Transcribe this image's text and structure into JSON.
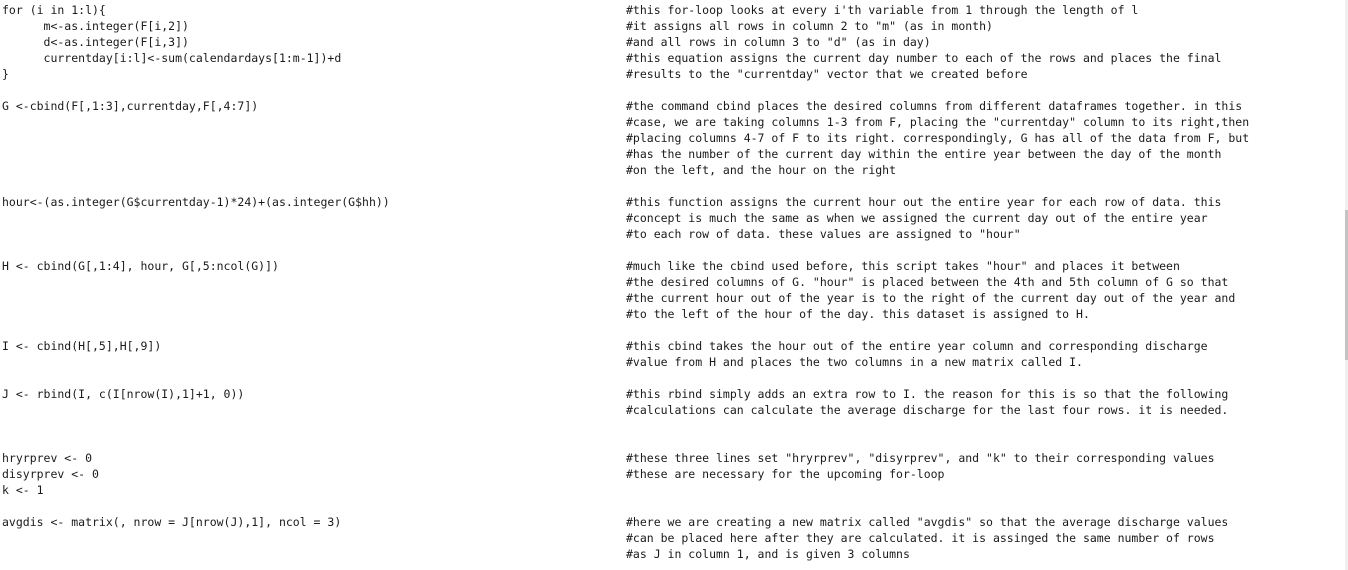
{
  "editor": {
    "lines": [
      {
        "code": "for (i in 1:l){",
        "comment": "#this for-loop looks at every i'th variable from 1 through the length of l"
      },
      {
        "code": "      m<-as.integer(F[i,2])",
        "comment": "#it assigns all rows in column 2 to \"m\" (as in month)"
      },
      {
        "code": "      d<-as.integer(F[i,3])",
        "comment": "#and all rows in column 3 to \"d\" (as in day)"
      },
      {
        "code": "      currentday[i:l]<-sum(calendardays[1:m-1])+d",
        "comment": "#this equation assigns the current day number to each of the rows and places the final"
      },
      {
        "code": "}",
        "comment": "#results to the \"currentday\" vector that we created before"
      },
      {
        "code": "",
        "comment": ""
      },
      {
        "code": "G <-cbind(F[,1:3],currentday,F[,4:7])",
        "comment": "#the command cbind places the desired columns from different dataframes together. in this"
      },
      {
        "code": "",
        "comment": "#case, we are taking columns 1-3 from F, placing the \"currentday\" column to its right,then"
      },
      {
        "code": "",
        "comment": "#placing columns 4-7 of F to its right. correspondingly, G has all of the data from F, but"
      },
      {
        "code": "",
        "comment": "#has the number of the current day within the entire year between the day of the month"
      },
      {
        "code": "",
        "comment": "#on the left, and the hour on the right"
      },
      {
        "code": "",
        "comment": ""
      },
      {
        "code": "hour<-(as.integer(G$currentday-1)*24)+(as.integer(G$hh))",
        "comment": "#this function assigns the current hour out the entire year for each row of data. this"
      },
      {
        "code": "",
        "comment": "#concept is much the same as when we assigned the current day out of the entire year"
      },
      {
        "code": "",
        "comment": "#to each row of data. these values are assigned to \"hour\""
      },
      {
        "code": "",
        "comment": ""
      },
      {
        "code": "H <- cbind(G[,1:4], hour, G[,5:ncol(G)])",
        "comment": "#much like the cbind used before, this script takes \"hour\" and places it between"
      },
      {
        "code": "",
        "comment": "#the desired columns of G. \"hour\" is placed between the 4th and 5th column of G so that"
      },
      {
        "code": "",
        "comment": "#the current hour out of the year is to the right of the current day out of the year and"
      },
      {
        "code": "",
        "comment": "#to the left of the hour of the day. this dataset is assigned to H."
      },
      {
        "code": "",
        "comment": ""
      },
      {
        "code": "I <- cbind(H[,5],H[,9])",
        "comment": "#this cbind takes the hour out of the entire year column and corresponding discharge"
      },
      {
        "code": "",
        "comment": "#value from H and places the two columns in a new matrix called I."
      },
      {
        "code": "",
        "comment": ""
      },
      {
        "code": "J <- rbind(I, c(I[nrow(I),1]+1, 0))",
        "comment": "#this rbind simply adds an extra row to I. the reason for this is so that the following"
      },
      {
        "code": "",
        "comment": "#calculations can calculate the average discharge for the last four rows. it is needed."
      },
      {
        "code": "",
        "comment": ""
      },
      {
        "code": "",
        "comment": ""
      },
      {
        "code": "hryrprev <- 0",
        "comment": "#these three lines set \"hryrprev\", \"disyrprev\", and \"k\" to their corresponding values"
      },
      {
        "code": "disyrprev <- 0",
        "comment": "#these are necessary for the upcoming for-loop"
      },
      {
        "code": "k <- 1",
        "comment": ""
      },
      {
        "code": "",
        "comment": ""
      },
      {
        "code": "avgdis <- matrix(, nrow = J[nrow(J),1], ncol = 3)",
        "comment": "#here we are creating a new matrix called \"avgdis\" so that the average discharge values"
      },
      {
        "code": "",
        "comment": "#can be placed here after they are calculated. it is assinged the same number of rows"
      },
      {
        "code": "",
        "comment": "#as J in column 1, and is given 3 columns"
      }
    ]
  }
}
